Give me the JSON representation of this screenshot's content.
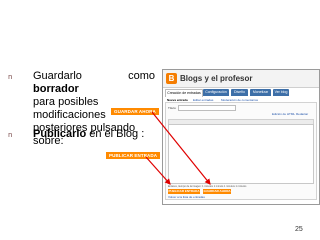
{
  "bullets": [
    {
      "marker": "n",
      "lines": [
        {
          "text": "Guardarlo   como   ",
          "bold": "borrador"
        },
        {
          "text": "para  posibles  modificaciones"
        },
        {
          "text": "posteriores pulsando sobre:"
        }
      ],
      "button_label": "GUARDAR AHORA"
    },
    {
      "marker": "n",
      "bold": "Publicarlo",
      "text": " en el Blog :",
      "button_label": "PUBLICAR ENTRADA"
    }
  ],
  "screenshot": {
    "app_title": "Blogs y el profesor",
    "tabs": [
      "Creación de entradas",
      "Configuración",
      "Diseño",
      "Monetizar",
      "Ver blog"
    ],
    "subtabs": [
      "Nueva entrada",
      "Editar entradas",
      "Moderación de comentarios"
    ],
    "title_label": "Título:",
    "edit_html_link": "Edición de HTML",
    "compose_link": "Redactar",
    "footer_text": "Enlaces, tiempo de la imagen: 1 minutos   1 minuto   1 minutos   1 minutos",
    "publish_button": "PUBLICAR ENTRADA",
    "save_button": "GUARDAR AHORA",
    "back_link": "Volver a la lista de entradas"
  },
  "colors": {
    "accent_orange": "#ff8a00",
    "arrow_red": "#e00000",
    "bullet_marker": "#7a4a4a",
    "tab_blue": "#3d6fa8"
  },
  "page_number": "25"
}
